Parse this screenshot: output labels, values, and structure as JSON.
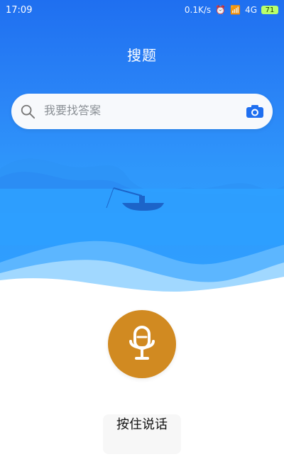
{
  "status_bar": {
    "time": "17:09",
    "speed": "0.1K/s",
    "network": "4G",
    "battery": "71"
  },
  "header": {
    "title": "搜题"
  },
  "search": {
    "placeholder": "我要找答案"
  },
  "voice": {
    "button_label": "按住说话"
  },
  "colors": {
    "primary": "#1f6ff0",
    "accent_mic": "#d18a21",
    "search_bg": "#f7f9fc"
  },
  "icons": {
    "search": "search-icon",
    "camera": "camera-icon",
    "mic": "microphone-icon",
    "alarm": "alarm-icon",
    "signal": "signal-icon",
    "battery": "battery-icon"
  }
}
